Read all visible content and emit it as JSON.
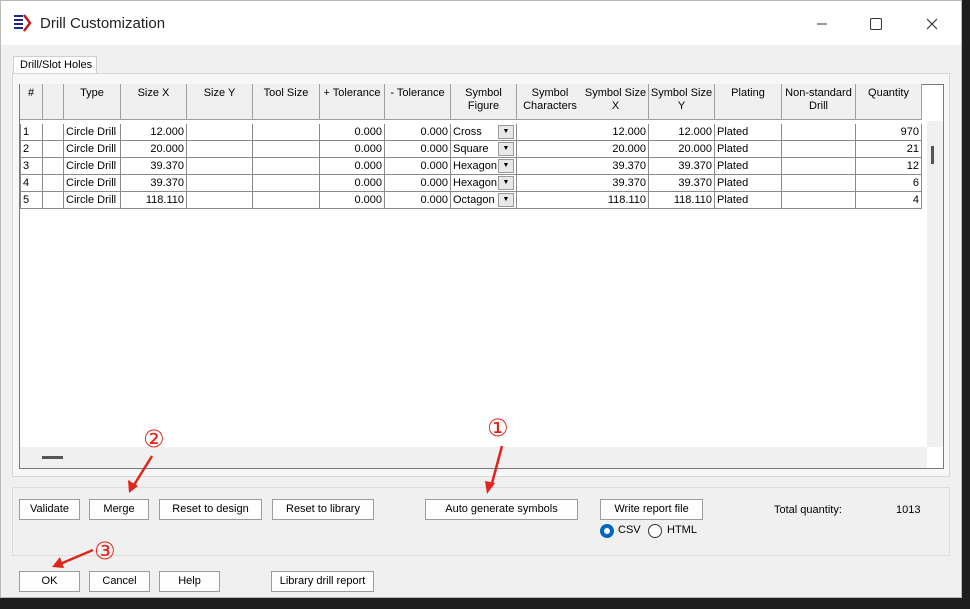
{
  "window": {
    "title": "Drill Customization"
  },
  "tab": {
    "label": "Drill/Slot Holes"
  },
  "table": {
    "headers": [
      {
        "key": "num",
        "label": "#"
      },
      {
        "key": "blank",
        "label": ""
      },
      {
        "key": "type",
        "label": "Type"
      },
      {
        "key": "sizex",
        "label": "Size X"
      },
      {
        "key": "sizey",
        "label": "Size Y"
      },
      {
        "key": "tool",
        "label": "Tool Size"
      },
      {
        "key": "ptol",
        "label": "+ Tolerance"
      },
      {
        "key": "mtol",
        "label": "- Tolerance"
      },
      {
        "key": "symfig",
        "label": "Symbol Figure"
      },
      {
        "key": "symch",
        "label": "Symbol Characters"
      },
      {
        "key": "ssx",
        "label": "Symbol Size X"
      },
      {
        "key": "ssy",
        "label": "Symbol Size Y"
      },
      {
        "key": "plating",
        "label": "Plating"
      },
      {
        "key": "nonstd",
        "label": "Non-standard Drill"
      },
      {
        "key": "qty",
        "label": "Quantity"
      }
    ],
    "rows": [
      {
        "num": "1",
        "type": "Circle Drill",
        "sizex": "12.000",
        "sizey": "",
        "tool": "",
        "ptol": "0.000",
        "mtol": "0.000",
        "symfig": "Cross",
        "symch": "",
        "ssx": "12.000",
        "ssy": "12.000",
        "plating": "Plated",
        "nonstd": "",
        "qty": "970"
      },
      {
        "num": "2",
        "type": "Circle Drill",
        "sizex": "20.000",
        "sizey": "",
        "tool": "",
        "ptol": "0.000",
        "mtol": "0.000",
        "symfig": "Square",
        "symch": "",
        "ssx": "20.000",
        "ssy": "20.000",
        "plating": "Plated",
        "nonstd": "",
        "qty": "21"
      },
      {
        "num": "3",
        "type": "Circle Drill",
        "sizex": "39.370",
        "sizey": "",
        "tool": "",
        "ptol": "0.000",
        "mtol": "0.000",
        "symfig": "Hexagon",
        "symch": "",
        "ssx": "39.370",
        "ssy": "39.370",
        "plating": "Plated",
        "nonstd": "",
        "qty": "12"
      },
      {
        "num": "4",
        "type": "Circle Drill",
        "sizex": "39.370",
        "sizey": "",
        "tool": "",
        "ptol": "0.000",
        "mtol": "0.000",
        "symfig": "Hexagon",
        "symch": "",
        "ssx": "39.370",
        "ssy": "39.370",
        "plating": "Plated",
        "nonstd": "",
        "qty": "6"
      },
      {
        "num": "5",
        "type": "Circle Drill",
        "sizex": "118.110",
        "sizey": "",
        "tool": "",
        "ptol": "0.000",
        "mtol": "0.000",
        "symfig": "Octagon",
        "symch": "",
        "ssx": "118.110",
        "ssy": "118.110",
        "plating": "Plated",
        "nonstd": "",
        "qty": "4"
      }
    ]
  },
  "buttons": {
    "validate": "Validate",
    "merge": "Merge",
    "reset_design": "Reset to design",
    "reset_library": "Reset to library",
    "auto_generate": "Auto generate symbols",
    "write_report": "Write report file",
    "ok": "OK",
    "cancel": "Cancel",
    "help": "Help",
    "library_report": "Library drill report"
  },
  "report_format": {
    "csv": "CSV",
    "html": "HTML",
    "selected": "CSV"
  },
  "total": {
    "label": "Total quantity:",
    "value": "1013"
  },
  "annotations": {
    "one": "①",
    "two": "②",
    "three": "③"
  },
  "colors": {
    "annotation": "#e0261b",
    "radio_selected": "#0067c0"
  }
}
